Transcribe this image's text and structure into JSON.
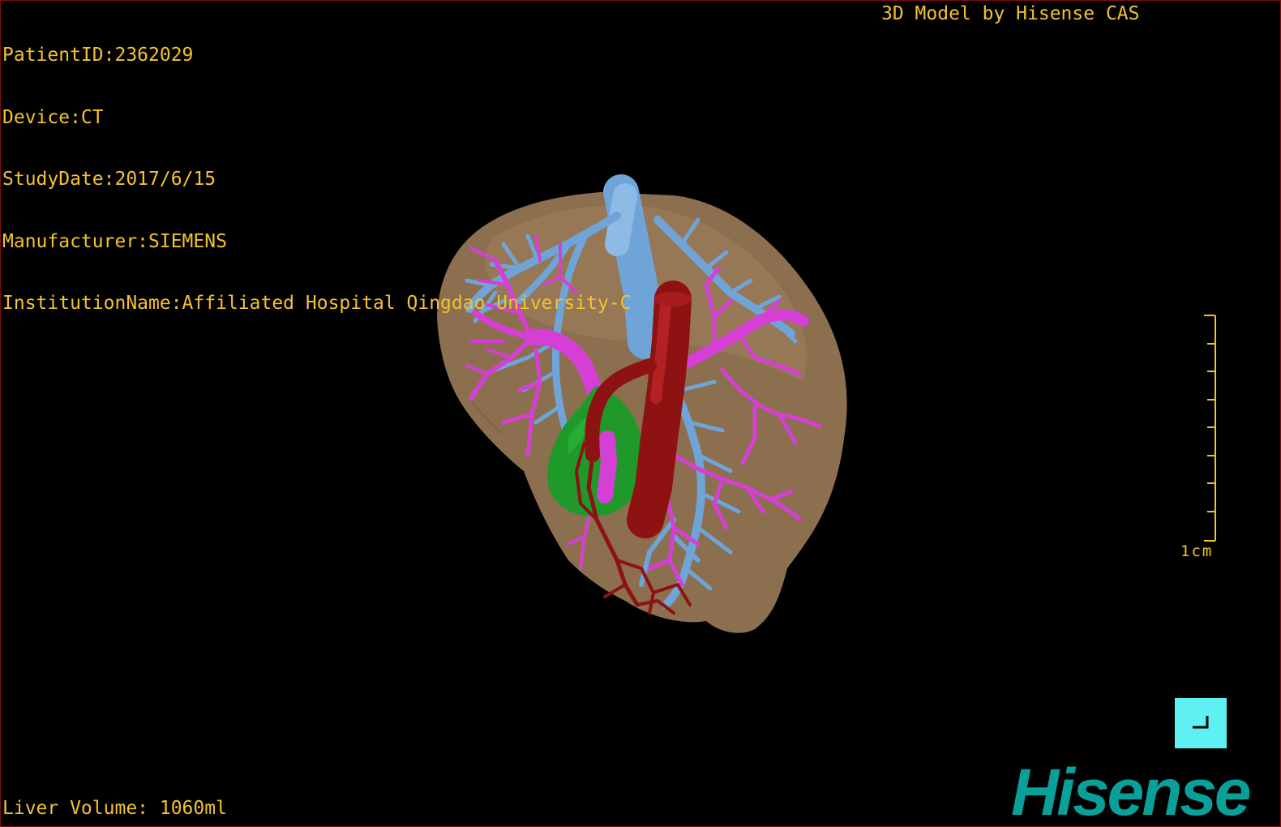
{
  "overlay": {
    "patient_id": "PatientID:2362029",
    "device": "Device:CT",
    "study_date": "StudyDate:2017/6/15",
    "manufacturer": "Manufacturer:SIEMENS",
    "institution": "InstitutionName:Affiliated Hospital Qingdao University-C",
    "credit": "3D Model by Hisense CAS",
    "liver_volume": "Liver Volume: 1060ml"
  },
  "scale_bar": {
    "label": "1cm"
  },
  "brand": {
    "logo_text": "Hisense"
  },
  "colors": {
    "overlay_text": "#f2c230",
    "liver": "#8c6f4f",
    "hepatic_vein": "#6fa4d8",
    "portal_vein": "#d63fd6",
    "artery": "#8e1212",
    "gallbladder": "#1f9a2a",
    "reset_button": "#5ff0f4",
    "logo": "#0aa09a"
  },
  "icons": {
    "reset_view": "corner-bracket-icon"
  }
}
